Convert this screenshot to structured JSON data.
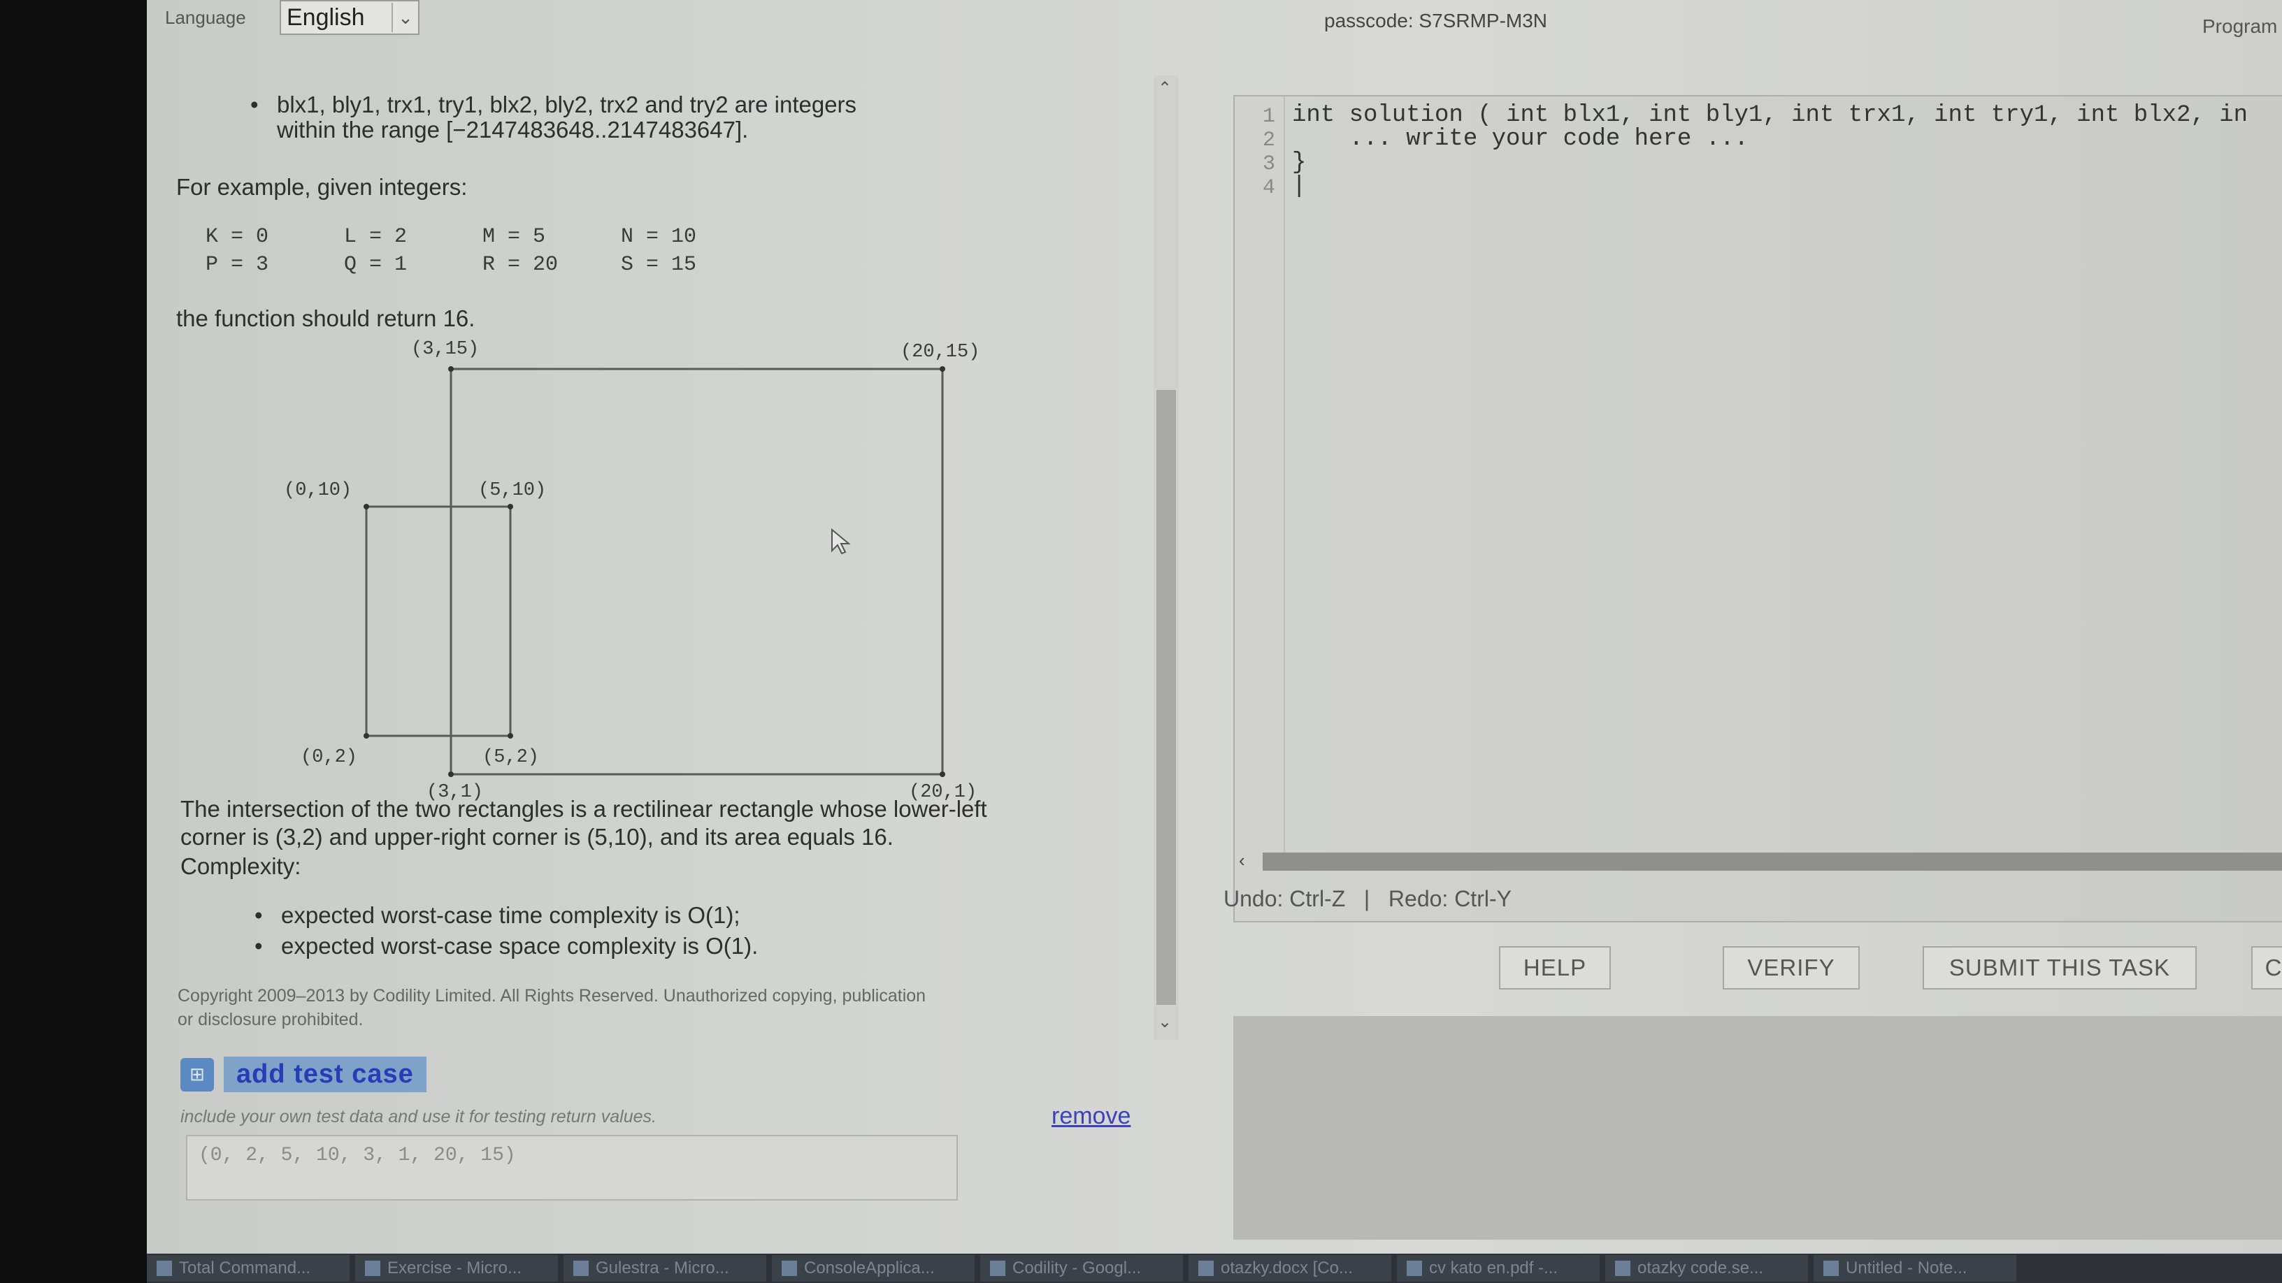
{
  "topbar": {
    "language_label": "Language",
    "language_value": "English",
    "passcode": "passcode: S7SRMP-M3N",
    "program_tab": "Program"
  },
  "task": {
    "bullet_integers": "blx1, bly1, trx1, try1, blx2, bly2, trx2 and try2 are integers",
    "bullet_integers_cont": "within the range [−2147483648..2147483647].",
    "example_intro": "For example, given integers:",
    "example_rows": [
      [
        "K = 0",
        "L = 2",
        "M = 5",
        "N = 10"
      ],
      [
        "P = 3",
        "Q = 1",
        "R = 20",
        "S = 15"
      ]
    ],
    "return_text": "the function should return 16.",
    "diagram_labels": {
      "a": "(3,15)",
      "b": "(20,15)",
      "c": "(0,10)",
      "d": "(5,10)",
      "e": "(0,2)",
      "f": "(5,2)",
      "g": "(3,1)",
      "h": "(20,1)"
    },
    "intersection_line1": "The intersection of the two rectangles is a rectilinear rectangle whose lower-left",
    "intersection_line2": "corner is (3,2) and upper-right corner is (5,10), and its area equals 16.",
    "complexity_heading": "Complexity:",
    "complexity_time": "expected worst-case time complexity is O(1);",
    "complexity_space": "expected worst-case space complexity is O(1).",
    "copyright_line1": "Copyright 2009–2013 by Codility Limited. All Rights Reserved. Unauthorized copying, publication",
    "copyright_line2": "or disclosure prohibited."
  },
  "test_case": {
    "add_label": "add test case",
    "hint": "include your own test data and use it for testing return values.",
    "remove_label": "remove",
    "input_value": "(0, 2, 5, 10, 3, 1, 20, 15)"
  },
  "editor": {
    "lines": [
      {
        "n": "1",
        "code": "int solution ( int blx1, int bly1, int trx1, int try1, int blx2, in"
      },
      {
        "n": "2",
        "code": "    ... write your code here ..."
      },
      {
        "n": "3",
        "code": "}"
      },
      {
        "n": "4",
        "code": "|"
      }
    ],
    "undo_redo": "Undo: Ctrl-Z   |   Redo: Ctrl-Y"
  },
  "buttons": {
    "help": "HELP",
    "verify": "VERIFY",
    "submit": "SUBMIT THIS TASK",
    "extra": "C"
  },
  "taskbar": {
    "items": [
      "Total Command...",
      "Exercise - Micro...",
      "Gulestra - Micro...",
      "ConsoleApplica...",
      "Codility - Googl...",
      "otazky.docx [Co...",
      "cv kato en.pdf -...",
      "otazky code.se...",
      "Untitled - Note..."
    ]
  },
  "colors": {
    "add_test_text": "#2a3bb8",
    "link": "#3a44b8",
    "taskbar": "#2e3238"
  }
}
